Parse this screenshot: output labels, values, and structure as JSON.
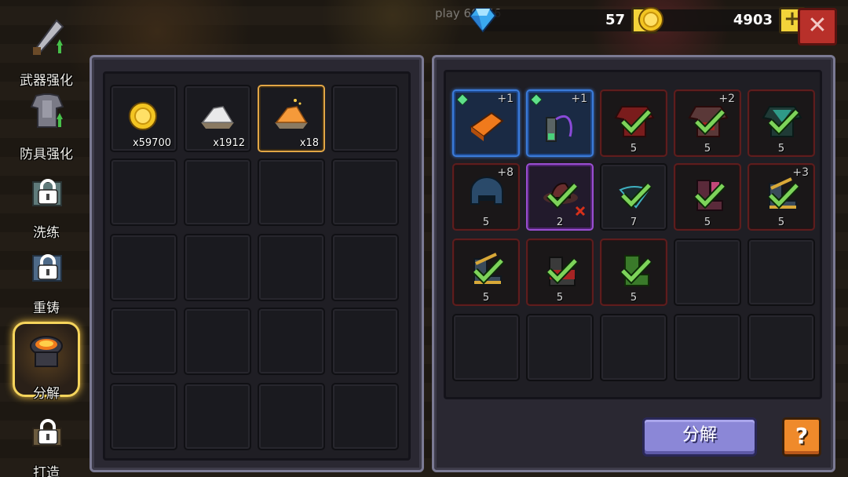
{
  "topbar": {
    "player_id": "play 60266",
    "gems": "57",
    "coins": "4903",
    "plus_label": "+",
    "close_label": "✕"
  },
  "sidebar": {
    "items": [
      {
        "label": "武器强化",
        "locked": false,
        "icon": "sword-upgrade-icon"
      },
      {
        "label": "防具强化",
        "locked": false,
        "icon": "armor-upgrade-icon"
      },
      {
        "label": "洗练",
        "locked": true,
        "icon": "lock-icon"
      },
      {
        "label": "重铸",
        "locked": true,
        "icon": "lock-icon"
      },
      {
        "label": "分解",
        "locked": false,
        "active": true,
        "icon": "furnace-icon"
      },
      {
        "label": "打造",
        "locked": true,
        "icon": "lock-icon"
      }
    ]
  },
  "materials": [
    {
      "icon": "gold-coin-icon",
      "count": "x59700"
    },
    {
      "icon": "white-ore-icon",
      "count": "x1912"
    },
    {
      "icon": "orange-ore-icon",
      "count": "x18"
    }
  ],
  "equipment": [
    {
      "icon": "orange-brick-icon",
      "plus": "+1",
      "level": "",
      "rarity": "blue"
    },
    {
      "icon": "whip-icon",
      "plus": "+1",
      "level": "",
      "rarity": "blue"
    },
    {
      "icon": "red-armor-icon",
      "plus": "",
      "level": "5",
      "rarity": "red"
    },
    {
      "icon": "red-armor-icon",
      "plus": "+2",
      "level": "5",
      "rarity": "red"
    },
    {
      "icon": "green-armor-icon",
      "plus": "",
      "level": "5",
      "rarity": "red"
    },
    {
      "icon": "blue-helmet-icon",
      "plus": "+8",
      "level": "5",
      "rarity": "red"
    },
    {
      "icon": "red-hat-icon",
      "plus": "",
      "level": "2",
      "rarity": "purple"
    },
    {
      "icon": "teal-hat-icon",
      "plus": "",
      "level": "7",
      "rarity": "plain"
    },
    {
      "icon": "pink-boots-icon",
      "plus": "",
      "level": "5",
      "rarity": "red"
    },
    {
      "icon": "gold-boots-icon",
      "plus": "+3",
      "level": "5",
      "rarity": "red"
    },
    {
      "icon": "gold-boots-icon",
      "plus": "",
      "level": "5",
      "rarity": "red"
    },
    {
      "icon": "red-boots-icon",
      "plus": "",
      "level": "5",
      "rarity": "red"
    },
    {
      "icon": "green-boots-icon",
      "plus": "",
      "level": "5",
      "rarity": "red"
    }
  ],
  "actions": {
    "decompose_label": "分解",
    "help_label": "?"
  },
  "colors": {
    "panel_border": "#7b7a93",
    "gold_slot": "#e2a645",
    "blue_slot": "#3b7bd9",
    "red_slot": "#5e1d1d",
    "purple_slot": "#9a4ed1",
    "check_green": "#7dd35a"
  }
}
